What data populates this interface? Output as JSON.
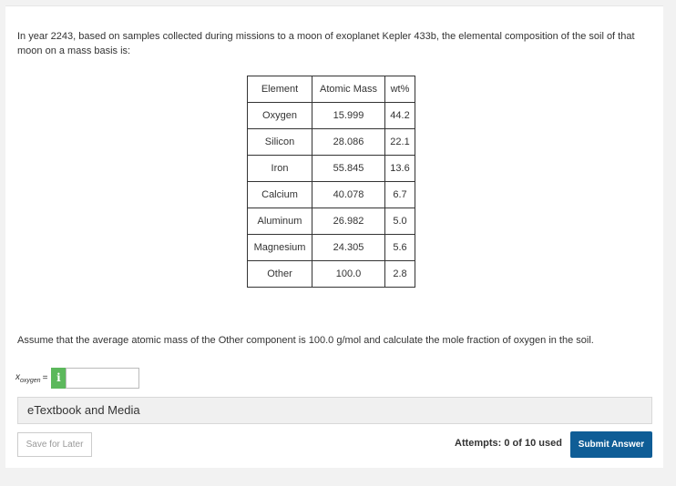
{
  "problem": {
    "text": "In year 2243, based on samples collected during missions to a moon of exoplanet Kepler 433b, the elemental composition of the soil of that moon on a mass basis is:"
  },
  "table": {
    "headers": [
      "Element",
      "Atomic Mass",
      "wt%"
    ],
    "rows": [
      [
        "Oxygen",
        "15.999",
        "44.2"
      ],
      [
        "Silicon",
        "28.086",
        "22.1"
      ],
      [
        "Iron",
        "55.845",
        "13.6"
      ],
      [
        "Calcium",
        "40.078",
        "6.7"
      ],
      [
        "Aluminum",
        "26.982",
        "5.0"
      ],
      [
        "Magnesium",
        "24.305",
        "5.6"
      ],
      [
        "Other",
        "100.0",
        "2.8"
      ]
    ]
  },
  "assumption": "Assume that the average atomic mass of the Other component is 100.0 g/mol and calculate the mole fraction of oxygen in the soil.",
  "answer": {
    "variable": "x",
    "subscript": "oxygen",
    "equals": "=",
    "info_icon": "i",
    "value": ""
  },
  "etextbook_label": "eTextbook and Media",
  "save_label": "Save for Later",
  "attempts_label": "Attempts: 0 of 10 used",
  "submit_label": "Submit Answer",
  "colors": {
    "submit": "#0f5d96",
    "info": "#5cb85c"
  }
}
